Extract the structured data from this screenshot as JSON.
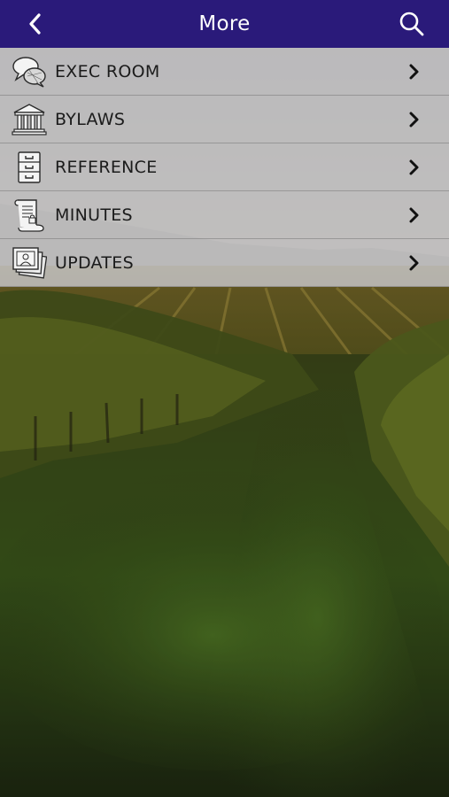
{
  "header": {
    "title": "More",
    "back_icon": "chevron-left-icon",
    "search_icon": "search-icon"
  },
  "menu": {
    "items": [
      {
        "label": "EXEC ROOM",
        "icon": "chat-bubbles-icon"
      },
      {
        "label": "BYLAWS",
        "icon": "courthouse-icon"
      },
      {
        "label": "REFERENCE",
        "icon": "file-cabinet-icon"
      },
      {
        "label": "MINUTES",
        "icon": "scroll-document-icon"
      },
      {
        "label": "UPDATES",
        "icon": "photo-stack-icon"
      }
    ]
  },
  "colors": {
    "header_bg": "#2a1a7a",
    "menu_bg": "#cdcdd2",
    "text": "#1b1b1b"
  }
}
